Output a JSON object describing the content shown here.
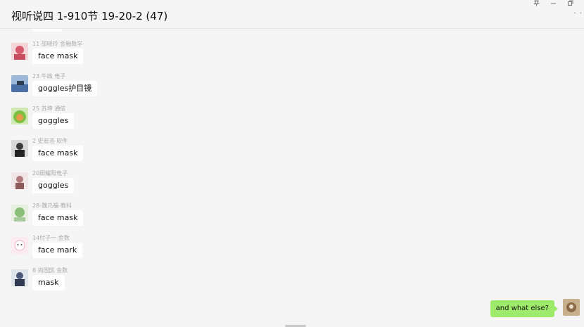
{
  "window": {
    "title": "视听说四 1-910节 19-20-2 (47)",
    "controls": [
      "pin-icon",
      "minimize-icon",
      "maximize-icon"
    ],
    "more_icon": "more-dots-icon"
  },
  "messages": [
    {
      "sender": "11 邵晓玲 金融数学",
      "text": "face mask",
      "avatar_color": "#d45a6b"
    },
    {
      "sender": "23 牛政 电子",
      "text": "goggles护目镜",
      "avatar_color": "#4a6fa5"
    },
    {
      "sender": "25 苏坤 通信",
      "text": "goggles",
      "avatar_color": "#7bc043"
    },
    {
      "sender": "2 史宏浩 软件",
      "text": "face mask",
      "avatar_color": "#3a3a3a"
    },
    {
      "sender": "20田耀阳电子",
      "text": "goggles",
      "avatar_color": "#b07a7a"
    },
    {
      "sender": "28-魏元福-教科",
      "text": "face mask",
      "avatar_color": "#8bbf7a"
    },
    {
      "sender": "14付子一 金数",
      "text": "face mark",
      "avatar_color": "#e9b3c4"
    },
    {
      "sender": "8 尚国凯 金数",
      "text": "mask",
      "avatar_color": "#4b5a7a"
    }
  ],
  "my_message": {
    "text": "and what else?",
    "bubble_color": "#9eea6a",
    "avatar_color": "#8a6a48"
  },
  "colors": {
    "background": "#f5f5f5",
    "bubble": "#ffffff",
    "sender_text": "#aaaaaa"
  }
}
